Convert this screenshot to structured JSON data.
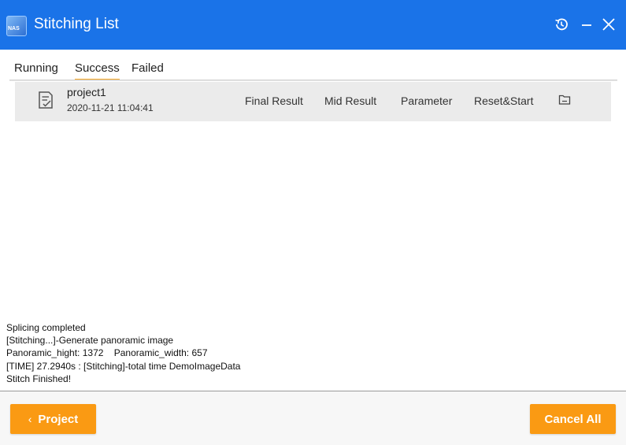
{
  "window": {
    "title": "Stitching List",
    "logo_text": "NAS"
  },
  "tabs": [
    {
      "label": "Running"
    },
    {
      "label": "Success",
      "active": true
    },
    {
      "label": "Failed"
    }
  ],
  "items": [
    {
      "name": "project1",
      "time": "2020-11-21 11:04:41",
      "actions": [
        "Final Result",
        "Mid Result",
        "Parameter",
        "Reset&Start"
      ]
    }
  ],
  "log": [
    "Splicing completed",
    "[Stitching...]-Generate panoramic image",
    "Panoramic_hight: 1372    Panoramic_width: 657",
    "[TIME] 27.2940s : [Stitching]-total time DemoImageData",
    "Stitch Finished!"
  ],
  "footer": {
    "back_label": "Project",
    "back_chevron": "‹",
    "cancel_label": "Cancel All"
  },
  "colors": {
    "titlebar": "#1a73e8",
    "accent": "#fa9a13",
    "tab_underline": "#f5a623"
  },
  "icons": {
    "history": "history-icon",
    "minimize": "minimize-icon",
    "close": "close-icon",
    "document": "document-check-icon",
    "folder": "folder-icon"
  }
}
